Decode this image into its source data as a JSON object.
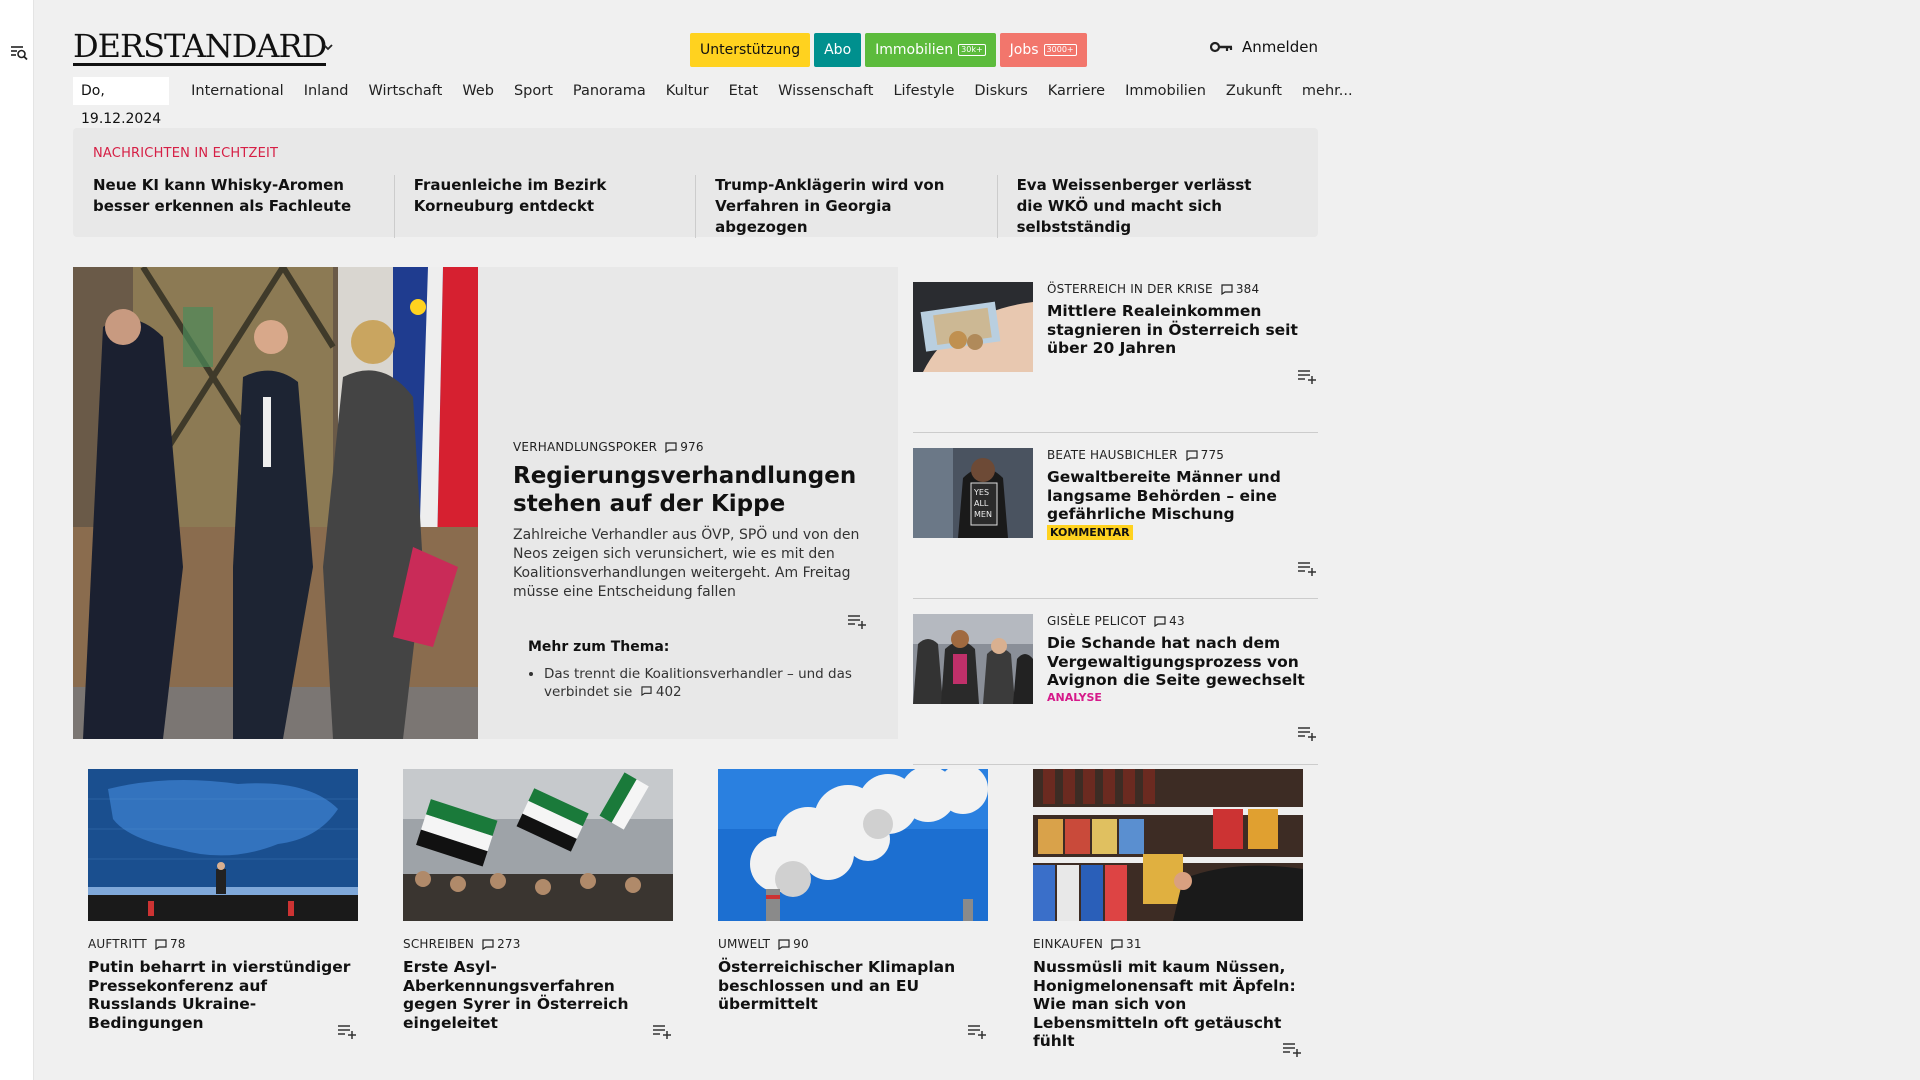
{
  "header": {
    "logo": "DERSTANDARD",
    "pills": [
      {
        "label": "Unterstützung",
        "badge": ""
      },
      {
        "label": "Abo",
        "badge": ""
      },
      {
        "label": "Immobilien",
        "badge": "30k+"
      },
      {
        "label": "Jobs",
        "badge": "3000+"
      }
    ],
    "login": "Anmelden"
  },
  "nav": {
    "date": "Do, 19.12.2024",
    "items": [
      "International",
      "Inland",
      "Wirtschaft",
      "Web",
      "Sport",
      "Panorama",
      "Kultur",
      "Etat",
      "Wissenschaft",
      "Lifestyle",
      "Diskurs",
      "Karriere",
      "Immobilien",
      "Zukunft",
      "mehr..."
    ]
  },
  "ticker": {
    "label": "NACHRICHTEN IN ECHTZEIT",
    "items": [
      "Neue KI kann Whisky-Aromen besser erkennen als Fachleute",
      "Frauenleiche im Bezirk Korneuburg entdeckt",
      "Trump-Anklägerin wird von Verfahren in Georgia abgezogen",
      "Eva Weissenberger verlässt die WKÖ und macht sich selbstständig"
    ]
  },
  "lead": {
    "kicker": "VERHANDLUNGSPOKER",
    "comments": "976",
    "title": "Regierungsverhandlungen stehen auf der Kippe",
    "text": "Zahlreiche Verhandler aus ÖVP, SPÖ und von den Neos zeigen sich verunsichert, wie es mit den Koalitionsverhandlungen weitergeht. Am Freitag müsse eine Entscheidung fallen",
    "more_label": "Mehr zum Thema:",
    "more_item": "Das trennt die Koalitionsverhandler – und das verbindet sie",
    "more_comments": "402"
  },
  "side": [
    {
      "kicker": "ÖSTERREICH IN DER KRISE",
      "comments": "384",
      "title": "Mittlere Realeinkommen stagnieren in Österreich seit über 20 Jahren",
      "tag": ""
    },
    {
      "kicker": "BEATE HAUSBICHLER",
      "comments": "775",
      "title": "Gewaltbereite Männer und langsame Behörden – eine gefährliche Mischung",
      "tag": "KOMMENTAR"
    },
    {
      "kicker": "GISÈLE PELICOT",
      "comments": "43",
      "title": "Die Schande hat nach dem Vergewaltigungsprozess von Avignon die Seite gewechselt",
      "tag": "ANALYSE"
    }
  ],
  "cards": [
    {
      "kicker": "AUFTRITT",
      "comments": "78",
      "title": "Putin beharrt in vierstündiger Pressekonferenz auf Russlands Ukraine-Bedingungen"
    },
    {
      "kicker": "SCHREIBEN",
      "comments": "273",
      "title": "Erste Asyl-Aberkennungsverfahren gegen Syrer in Österreich eingeleitet"
    },
    {
      "kicker": "UMWELT",
      "comments": "90",
      "title": "Österreichischer Klimaplan beschlossen und an EU übermittelt"
    },
    {
      "kicker": "EINKAUFEN",
      "comments": "31",
      "title": "Nussmüsli mit kaum Nüssen, Honigmelonensaft mit Äpfeln: Wie man sich von Lebensmitteln oft getäuscht fühlt"
    }
  ],
  "colors": {
    "accent_red": "#d61f45",
    "support": "#ffd21f",
    "abo": "#00908e",
    "immo": "#5cbb3c",
    "jobs": "#f2766c",
    "analyse": "#d6198a"
  }
}
